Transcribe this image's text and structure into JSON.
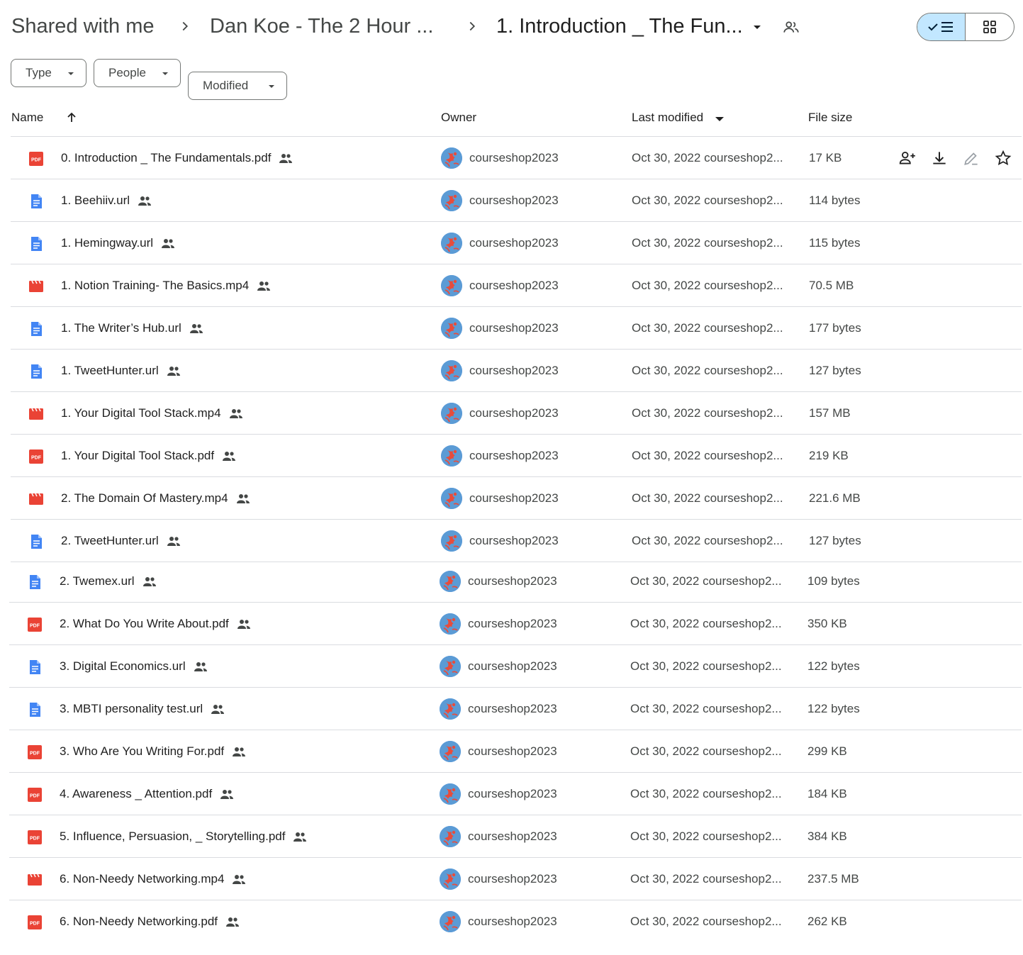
{
  "breadcrumb": {
    "items": [
      "Shared with me",
      "Dan Koe - The 2 Hour ...",
      "1. Introduction _ The Fun..."
    ]
  },
  "filters": [
    {
      "label": "Type"
    },
    {
      "label": "People"
    },
    {
      "label": "Modified"
    }
  ],
  "columns": {
    "name": "Name",
    "owner": "Owner",
    "modified": "Last modified",
    "size": "File size"
  },
  "colors": {
    "pdf": "#ea4335",
    "doc": "#4285f4",
    "video": "#ea4335",
    "toggle_active": "#c2e7ff"
  },
  "files": [
    {
      "name": "0. Introduction _ The Fundamentals.pdf",
      "type": "pdf",
      "owner": "courseshop2023",
      "modified": "Oct 30, 2022 courseshop2...",
      "size": "17 KB"
    },
    {
      "name": "1. Beehiiv.url",
      "type": "doc",
      "owner": "courseshop2023",
      "modified": "Oct 30, 2022 courseshop2...",
      "size": "114 bytes"
    },
    {
      "name": "1. Hemingway.url",
      "type": "doc",
      "owner": "courseshop2023",
      "modified": "Oct 30, 2022 courseshop2...",
      "size": "115 bytes"
    },
    {
      "name": "1. Notion Training- The Basics.mp4",
      "type": "video",
      "owner": "courseshop2023",
      "modified": "Oct 30, 2022 courseshop2...",
      "size": "70.5 MB"
    },
    {
      "name": "1. The Writer’s Hub.url",
      "type": "doc",
      "owner": "courseshop2023",
      "modified": "Oct 30, 2022 courseshop2...",
      "size": "177 bytes"
    },
    {
      "name": "1. TweetHunter.url",
      "type": "doc",
      "owner": "courseshop2023",
      "modified": "Oct 30, 2022 courseshop2...",
      "size": "127 bytes"
    },
    {
      "name": "1. Your Digital Tool Stack.mp4",
      "type": "video",
      "owner": "courseshop2023",
      "modified": "Oct 30, 2022 courseshop2...",
      "size": "157 MB"
    },
    {
      "name": "1. Your Digital Tool Stack.pdf",
      "type": "pdf",
      "owner": "courseshop2023",
      "modified": "Oct 30, 2022 courseshop2...",
      "size": "219 KB"
    },
    {
      "name": "2. The Domain Of Mastery.mp4",
      "type": "video",
      "owner": "courseshop2023",
      "modified": "Oct 30, 2022 courseshop2...",
      "size": "221.6 MB"
    },
    {
      "name": "2. TweetHunter.url",
      "type": "doc",
      "owner": "courseshop2023",
      "modified": "Oct 30, 2022 courseshop2...",
      "size": "127 bytes"
    },
    {
      "name": "2. Twemex.url",
      "type": "doc",
      "owner": "courseshop2023",
      "modified": "Oct 30, 2022 courseshop2...",
      "size": "109 bytes"
    },
    {
      "name": "2. What Do You Write About.pdf",
      "type": "pdf",
      "owner": "courseshop2023",
      "modified": "Oct 30, 2022 courseshop2...",
      "size": "350 KB"
    },
    {
      "name": "3. Digital Economics.url",
      "type": "doc",
      "owner": "courseshop2023",
      "modified": "Oct 30, 2022 courseshop2...",
      "size": "122 bytes"
    },
    {
      "name": "3. MBTI personality test.url",
      "type": "doc",
      "owner": "courseshop2023",
      "modified": "Oct 30, 2022 courseshop2...",
      "size": "122 bytes"
    },
    {
      "name": "3. Who Are You Writing For.pdf",
      "type": "pdf",
      "owner": "courseshop2023",
      "modified": "Oct 30, 2022 courseshop2...",
      "size": "299 KB"
    },
    {
      "name": "4. Awareness _ Attention.pdf",
      "type": "pdf",
      "owner": "courseshop2023",
      "modified": "Oct 30, 2022 courseshop2...",
      "size": "184 KB"
    },
    {
      "name": "5. Influence, Persuasion, _ Storytelling.pdf",
      "type": "pdf",
      "owner": "courseshop2023",
      "modified": "Oct 30, 2022 courseshop2...",
      "size": "384 KB"
    },
    {
      "name": "6. Non-Needy Networking.mp4",
      "type": "video",
      "owner": "courseshop2023",
      "modified": "Oct 30, 2022 courseshop2...",
      "size": "237.5 MB"
    },
    {
      "name": "6. Non-Needy Networking.pdf",
      "type": "pdf",
      "owner": "courseshop2023",
      "modified": "Oct 30, 2022 courseshop2...",
      "size": "262 KB"
    }
  ]
}
